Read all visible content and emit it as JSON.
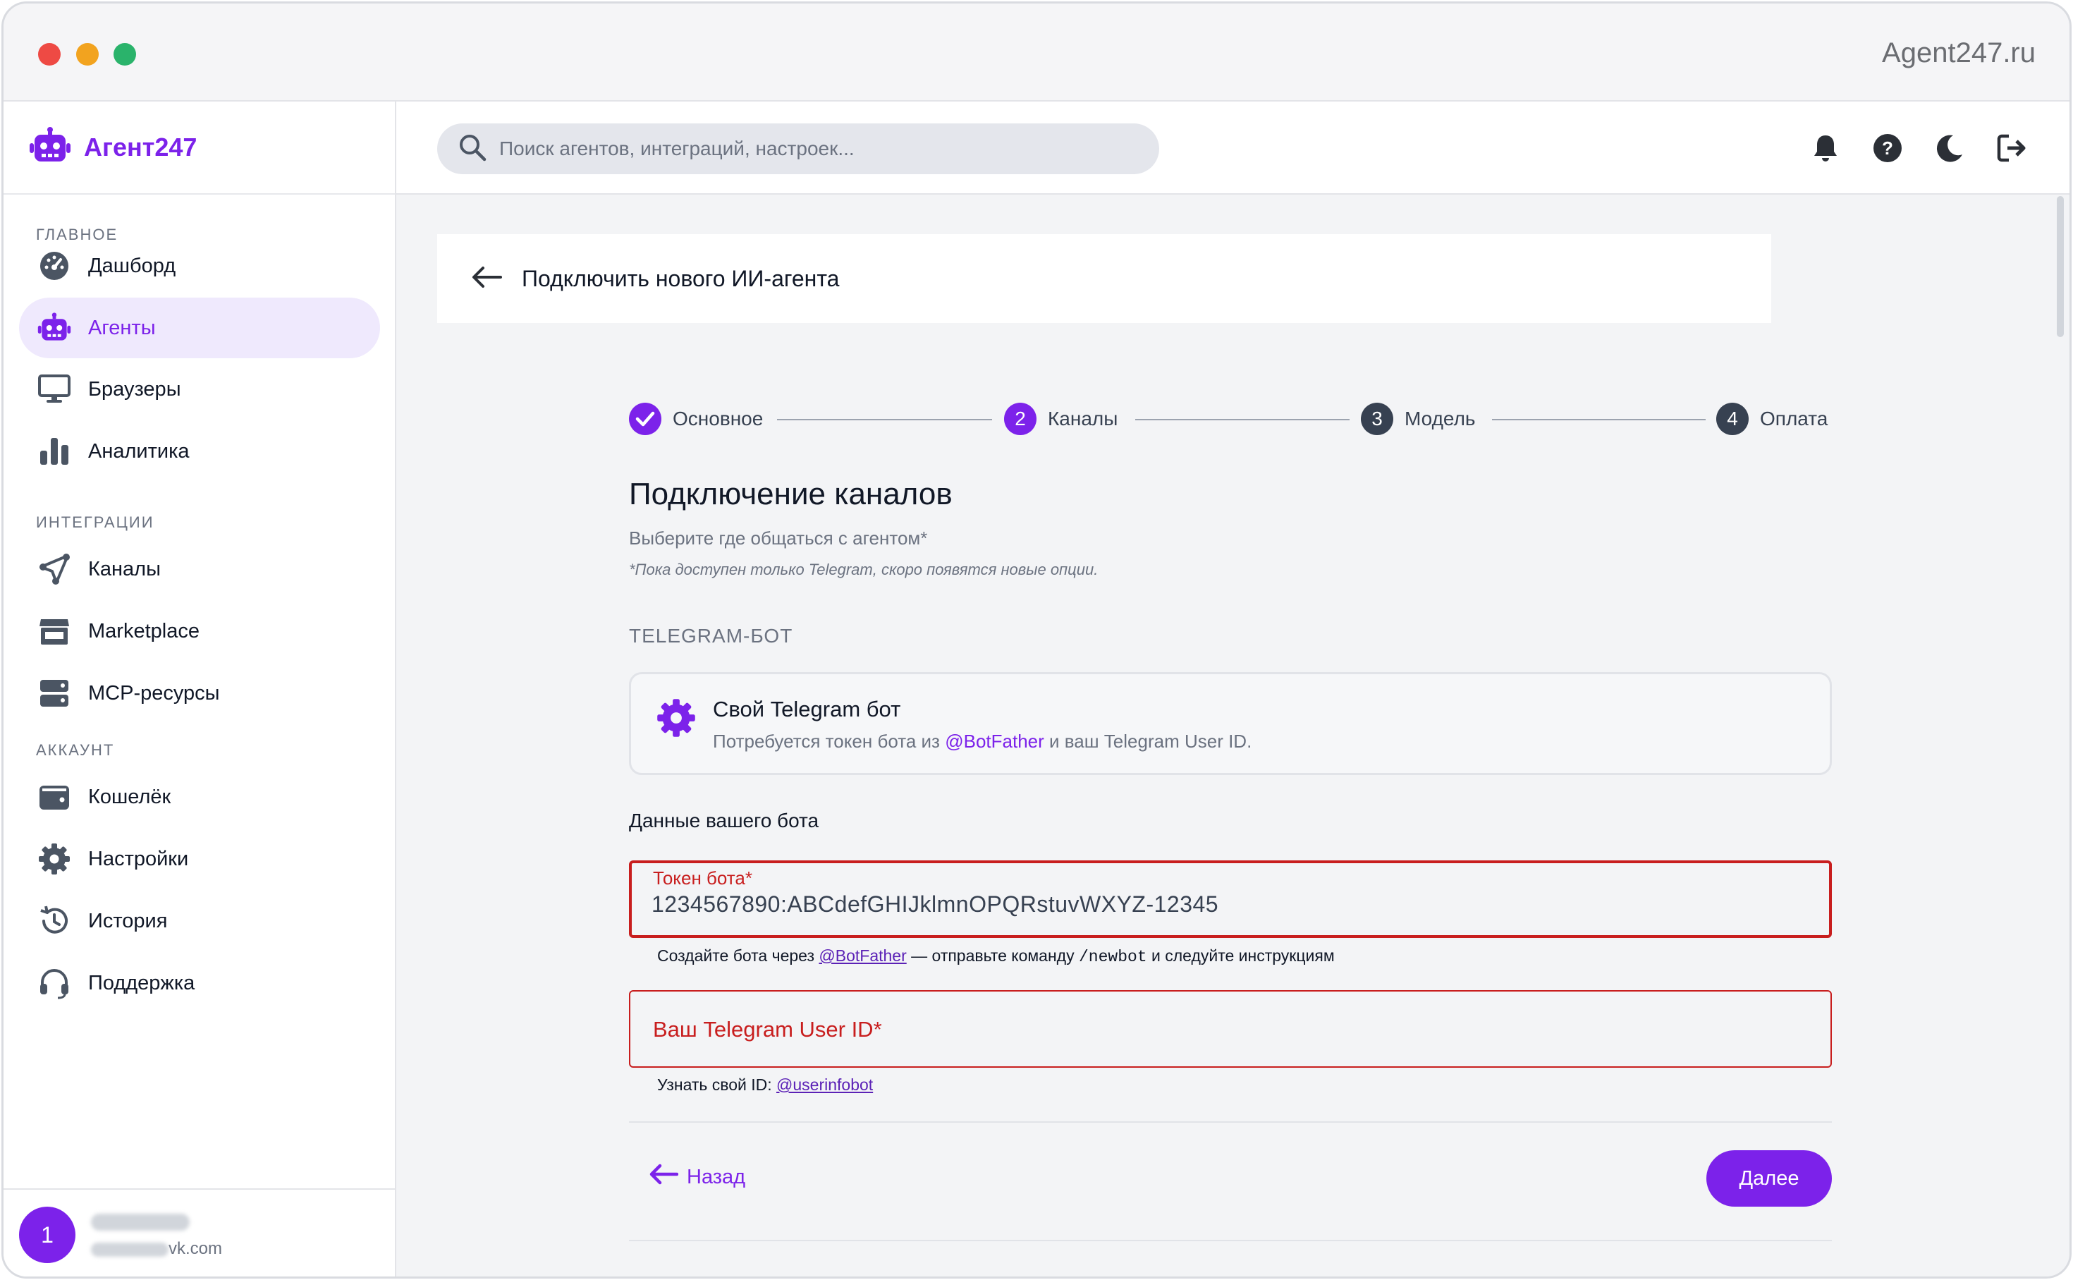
{
  "window": {
    "site": "Agent247.ru"
  },
  "brand": {
    "name": "Агент247"
  },
  "sidebar": {
    "sections": {
      "main": "ГЛАВНОЕ",
      "integrations": "ИНТЕГРАЦИИ",
      "account": "АККАУНТ"
    },
    "items": [
      {
        "label": "Дашборд",
        "icon": "dashboard-gauge-icon"
      },
      {
        "label": "Агенты",
        "icon": "robot-icon",
        "active": true
      },
      {
        "label": "Браузеры",
        "icon": "monitor-icon"
      },
      {
        "label": "Аналитика",
        "icon": "bar-chart-icon"
      },
      {
        "label": "Каналы",
        "icon": "send-share-icon"
      },
      {
        "label": "Marketplace",
        "icon": "store-icon"
      },
      {
        "label": "MCP-ресурсы",
        "icon": "server-icon"
      },
      {
        "label": "Кошелёк",
        "icon": "wallet-icon"
      },
      {
        "label": "Настройки",
        "icon": "gear-icon"
      },
      {
        "label": "История",
        "icon": "history-icon"
      },
      {
        "label": "Поддержка",
        "icon": "headset-icon"
      }
    ]
  },
  "user": {
    "avatar": "1",
    "email_suffix": "vk.com"
  },
  "search": {
    "placeholder": "Поиск агентов, интеграций, настроек..."
  },
  "header": {
    "title": "Подключить нового ИИ-агента"
  },
  "stepper": {
    "steps": [
      {
        "num": "",
        "label": "Основное",
        "state": "done"
      },
      {
        "num": "2",
        "label": "Каналы",
        "state": "active"
      },
      {
        "num": "3",
        "label": "Модель",
        "state": "pending"
      },
      {
        "num": "4",
        "label": "Оплата",
        "state": "pending"
      }
    ]
  },
  "main": {
    "heading": "Подключение каналов",
    "subtitle": "Выберите где общаться с агентом*",
    "note": "*Пока доступен только Telegram, скоро появятся новые опции.",
    "section_caption": "TELEGRAM-БОТ",
    "option": {
      "title": "Свой Telegram бот",
      "desc_before": "Потребуется токен бота из ",
      "desc_link": "@BotFather",
      "desc_after": " и ваш Telegram User ID."
    },
    "form_caption": "Данные вашего бота",
    "token_field": {
      "label": "Токен бота*",
      "value": "1234567890:ABCdefGHIJklmnOPQRstuvWXYZ-12345",
      "hint_before": "Создайте бота через ",
      "hint_link": "@BotFather",
      "hint_middle": " — отправьте команду ",
      "hint_code": "/newbot",
      "hint_after": " и следуйте инструкциям"
    },
    "userid_field": {
      "label": "Ваш Telegram User ID*",
      "hint_before": "Узнать свой ID: ",
      "hint_link": "@userinfobot"
    },
    "back_label": "Назад",
    "next_label": "Далее"
  },
  "colors": {
    "accent": "#7c22ea",
    "error": "#c81e1e",
    "pending_step": "#374151"
  }
}
